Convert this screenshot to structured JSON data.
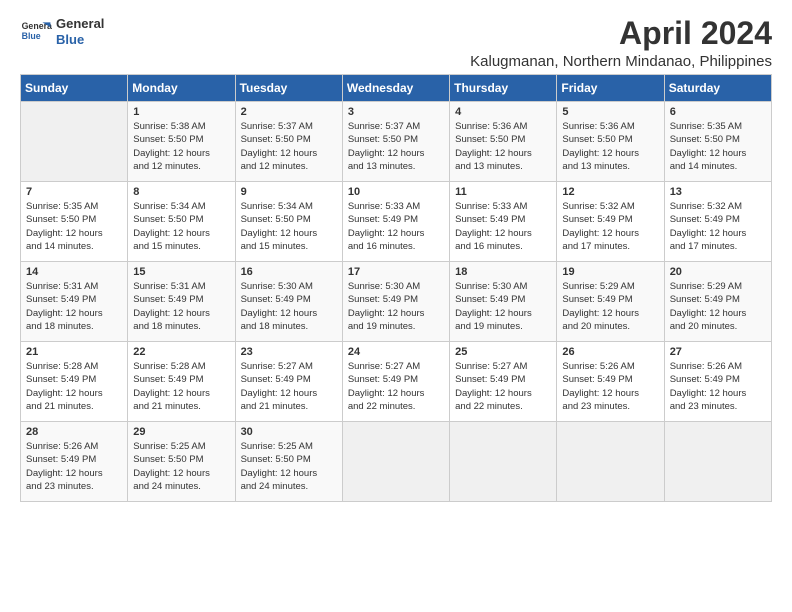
{
  "logo": {
    "line1": "General",
    "line2": "Blue"
  },
  "title": "April 2024",
  "subtitle": "Kalugmanan, Northern Mindanao, Philippines",
  "headers": [
    "Sunday",
    "Monday",
    "Tuesday",
    "Wednesday",
    "Thursday",
    "Friday",
    "Saturday"
  ],
  "weeks": [
    [
      {
        "day": "",
        "info": ""
      },
      {
        "day": "1",
        "info": "Sunrise: 5:38 AM\nSunset: 5:50 PM\nDaylight: 12 hours\nand 12 minutes."
      },
      {
        "day": "2",
        "info": "Sunrise: 5:37 AM\nSunset: 5:50 PM\nDaylight: 12 hours\nand 12 minutes."
      },
      {
        "day": "3",
        "info": "Sunrise: 5:37 AM\nSunset: 5:50 PM\nDaylight: 12 hours\nand 13 minutes."
      },
      {
        "day": "4",
        "info": "Sunrise: 5:36 AM\nSunset: 5:50 PM\nDaylight: 12 hours\nand 13 minutes."
      },
      {
        "day": "5",
        "info": "Sunrise: 5:36 AM\nSunset: 5:50 PM\nDaylight: 12 hours\nand 13 minutes."
      },
      {
        "day": "6",
        "info": "Sunrise: 5:35 AM\nSunset: 5:50 PM\nDaylight: 12 hours\nand 14 minutes."
      }
    ],
    [
      {
        "day": "7",
        "info": "Sunrise: 5:35 AM\nSunset: 5:50 PM\nDaylight: 12 hours\nand 14 minutes."
      },
      {
        "day": "8",
        "info": "Sunrise: 5:34 AM\nSunset: 5:50 PM\nDaylight: 12 hours\nand 15 minutes."
      },
      {
        "day": "9",
        "info": "Sunrise: 5:34 AM\nSunset: 5:50 PM\nDaylight: 12 hours\nand 15 minutes."
      },
      {
        "day": "10",
        "info": "Sunrise: 5:33 AM\nSunset: 5:49 PM\nDaylight: 12 hours\nand 16 minutes."
      },
      {
        "day": "11",
        "info": "Sunrise: 5:33 AM\nSunset: 5:49 PM\nDaylight: 12 hours\nand 16 minutes."
      },
      {
        "day": "12",
        "info": "Sunrise: 5:32 AM\nSunset: 5:49 PM\nDaylight: 12 hours\nand 17 minutes."
      },
      {
        "day": "13",
        "info": "Sunrise: 5:32 AM\nSunset: 5:49 PM\nDaylight: 12 hours\nand 17 minutes."
      }
    ],
    [
      {
        "day": "14",
        "info": "Sunrise: 5:31 AM\nSunset: 5:49 PM\nDaylight: 12 hours\nand 18 minutes."
      },
      {
        "day": "15",
        "info": "Sunrise: 5:31 AM\nSunset: 5:49 PM\nDaylight: 12 hours\nand 18 minutes."
      },
      {
        "day": "16",
        "info": "Sunrise: 5:30 AM\nSunset: 5:49 PM\nDaylight: 12 hours\nand 18 minutes."
      },
      {
        "day": "17",
        "info": "Sunrise: 5:30 AM\nSunset: 5:49 PM\nDaylight: 12 hours\nand 19 minutes."
      },
      {
        "day": "18",
        "info": "Sunrise: 5:30 AM\nSunset: 5:49 PM\nDaylight: 12 hours\nand 19 minutes."
      },
      {
        "day": "19",
        "info": "Sunrise: 5:29 AM\nSunset: 5:49 PM\nDaylight: 12 hours\nand 20 minutes."
      },
      {
        "day": "20",
        "info": "Sunrise: 5:29 AM\nSunset: 5:49 PM\nDaylight: 12 hours\nand 20 minutes."
      }
    ],
    [
      {
        "day": "21",
        "info": "Sunrise: 5:28 AM\nSunset: 5:49 PM\nDaylight: 12 hours\nand 21 minutes."
      },
      {
        "day": "22",
        "info": "Sunrise: 5:28 AM\nSunset: 5:49 PM\nDaylight: 12 hours\nand 21 minutes."
      },
      {
        "day": "23",
        "info": "Sunrise: 5:27 AM\nSunset: 5:49 PM\nDaylight: 12 hours\nand 21 minutes."
      },
      {
        "day": "24",
        "info": "Sunrise: 5:27 AM\nSunset: 5:49 PM\nDaylight: 12 hours\nand 22 minutes."
      },
      {
        "day": "25",
        "info": "Sunrise: 5:27 AM\nSunset: 5:49 PM\nDaylight: 12 hours\nand 22 minutes."
      },
      {
        "day": "26",
        "info": "Sunrise: 5:26 AM\nSunset: 5:49 PM\nDaylight: 12 hours\nand 23 minutes."
      },
      {
        "day": "27",
        "info": "Sunrise: 5:26 AM\nSunset: 5:49 PM\nDaylight: 12 hours\nand 23 minutes."
      }
    ],
    [
      {
        "day": "28",
        "info": "Sunrise: 5:26 AM\nSunset: 5:49 PM\nDaylight: 12 hours\nand 23 minutes."
      },
      {
        "day": "29",
        "info": "Sunrise: 5:25 AM\nSunset: 5:50 PM\nDaylight: 12 hours\nand 24 minutes."
      },
      {
        "day": "30",
        "info": "Sunrise: 5:25 AM\nSunset: 5:50 PM\nDaylight: 12 hours\nand 24 minutes."
      },
      {
        "day": "",
        "info": ""
      },
      {
        "day": "",
        "info": ""
      },
      {
        "day": "",
        "info": ""
      },
      {
        "day": "",
        "info": ""
      }
    ]
  ]
}
